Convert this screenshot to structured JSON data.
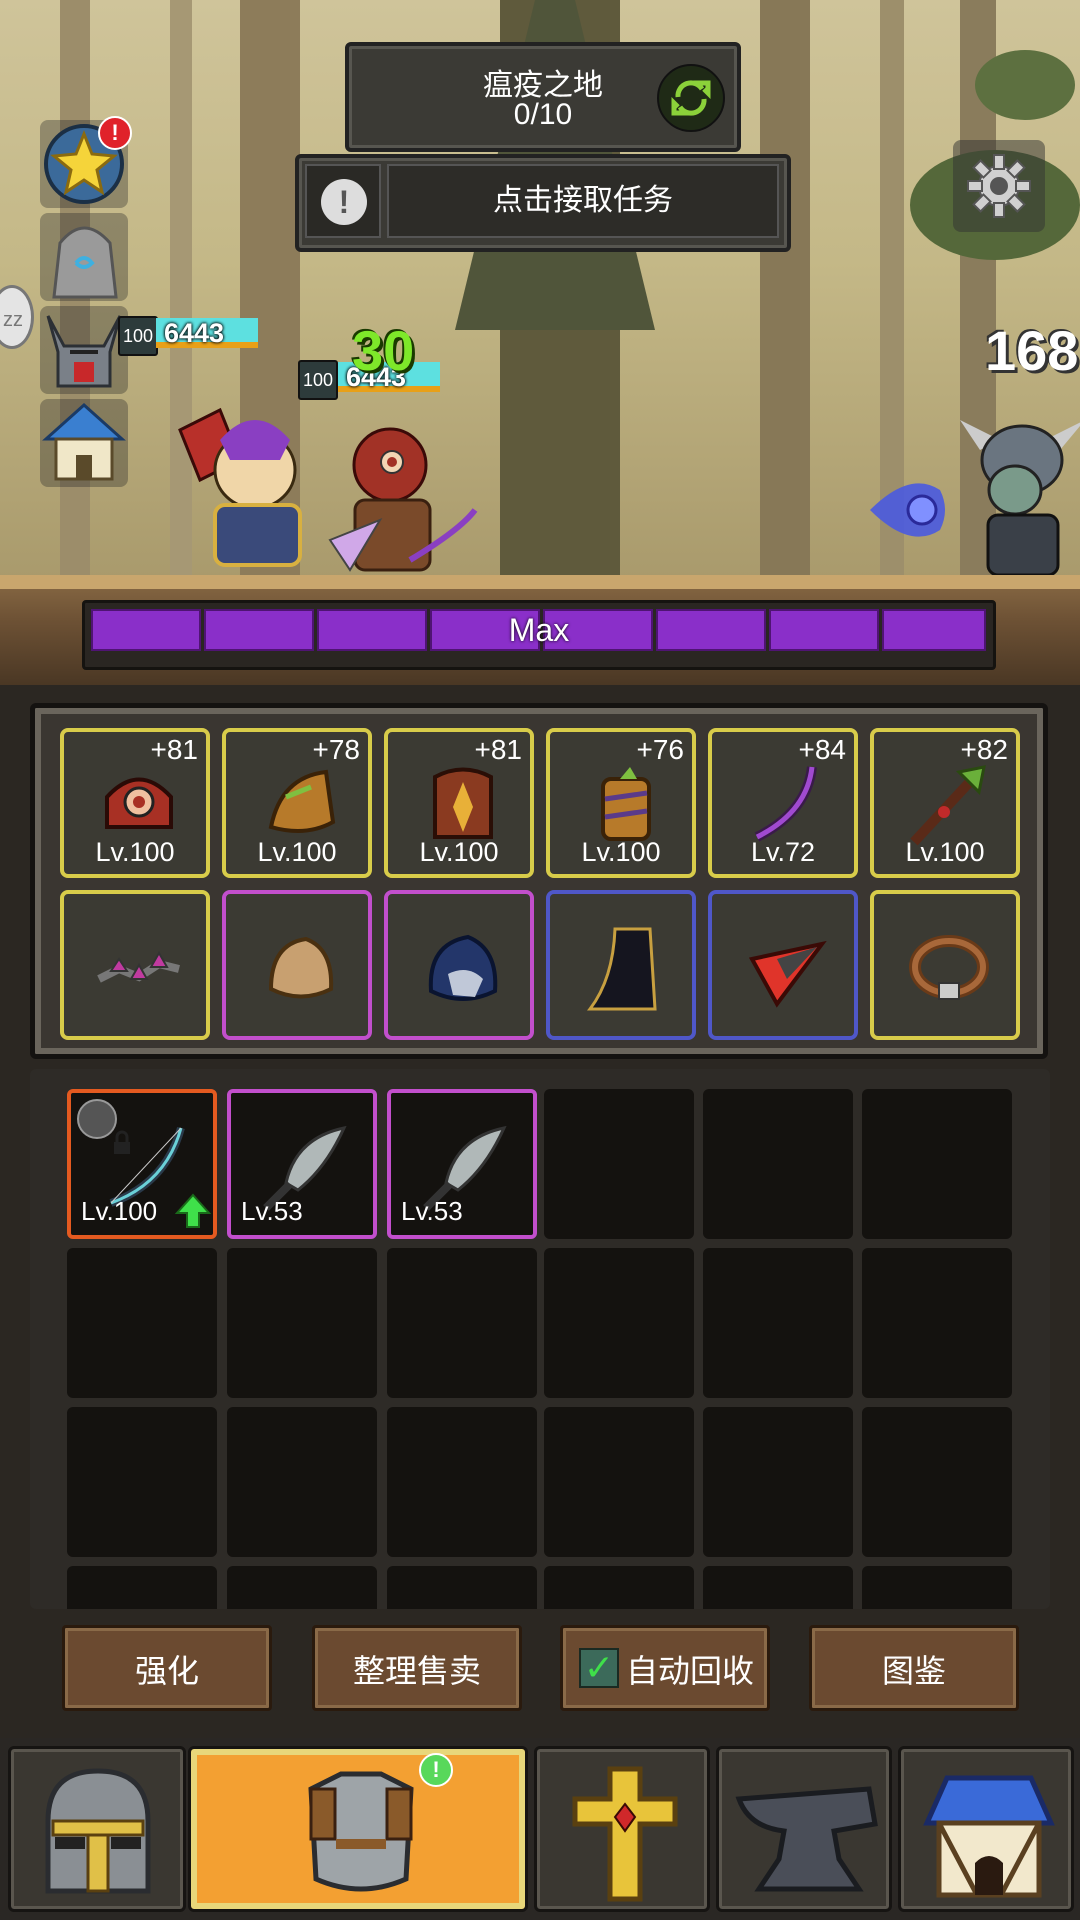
{
  "hud": {
    "zone_name": "瘟疫之地",
    "zone_progress": "0/10",
    "quest_text": "点击接取任务",
    "quest_icon": "exclamation-icon",
    "refresh_icon": "refresh-icon",
    "settings_icon": "gear-icon",
    "side_buttons": [
      "star-achievement-icon",
      "rune-stone-icon",
      "horned-helmet-icon",
      "house-icon"
    ],
    "side_badge": "!"
  },
  "battle": {
    "hero1": {
      "level": "100",
      "hp": "6443"
    },
    "hero2": {
      "level": "100",
      "hp": "6443"
    },
    "damage_hero": "30",
    "damage_enemy": "168",
    "sleep_icon": "zz"
  },
  "exp": {
    "label": "Max",
    "segments": 8
  },
  "equipped": [
    {
      "icon": "red-helmet-icon",
      "plus": "+81",
      "level": "Lv.100",
      "rarity": "gold"
    },
    {
      "icon": "shoulder-armor-icon",
      "plus": "+78",
      "level": "Lv.100",
      "rarity": "gold"
    },
    {
      "icon": "chest-armor-icon",
      "plus": "+81",
      "level": "Lv.100",
      "rarity": "gold"
    },
    {
      "icon": "gauntlet-icon",
      "plus": "+76",
      "level": "Lv.100",
      "rarity": "gold"
    },
    {
      "icon": "purple-bow-icon",
      "plus": "+84",
      "level": "Lv.72",
      "rarity": "gold"
    },
    {
      "icon": "green-staff-icon",
      "plus": "+82",
      "level": "Lv.100",
      "rarity": "gold"
    },
    {
      "icon": "spiked-necklace-icon",
      "rarity": "gold"
    },
    {
      "icon": "leather-cap-icon",
      "rarity": "purple"
    },
    {
      "icon": "blue-hood-icon",
      "rarity": "purple"
    },
    {
      "icon": "dark-cape-icon",
      "rarity": "blue"
    },
    {
      "icon": "red-arrowhead-icon",
      "rarity": "blue"
    },
    {
      "icon": "leather-ring-icon",
      "rarity": "gold"
    }
  ],
  "inventory": [
    {
      "icon": "crystal-bow-icon",
      "level": "Lv.100",
      "rarity": "orange",
      "locked": true,
      "upgrade": true
    },
    {
      "icon": "scimitar-icon",
      "level": "Lv.53",
      "rarity": "purple"
    },
    {
      "icon": "scimitar-icon",
      "level": "Lv.53",
      "rarity": "purple"
    }
  ],
  "actions": {
    "enhance": "强化",
    "sort_sell": "整理售卖",
    "auto_recycle": "自动回收",
    "auto_recycle_checked": true,
    "codex": "图鉴"
  },
  "nav": {
    "tabs": [
      "knight-helmet-icon",
      "chest-armor-icon",
      "golden-cross-icon",
      "anvil-icon",
      "shop-house-icon"
    ],
    "active": 1,
    "badge": "!"
  },
  "colors": {
    "gold": "#d8cc4a",
    "purple": "#c24fcc",
    "blue": "#4f57c8",
    "orange": "#e45a20",
    "exp": "#8a2fc9",
    "active_tab": "#f3a032"
  }
}
